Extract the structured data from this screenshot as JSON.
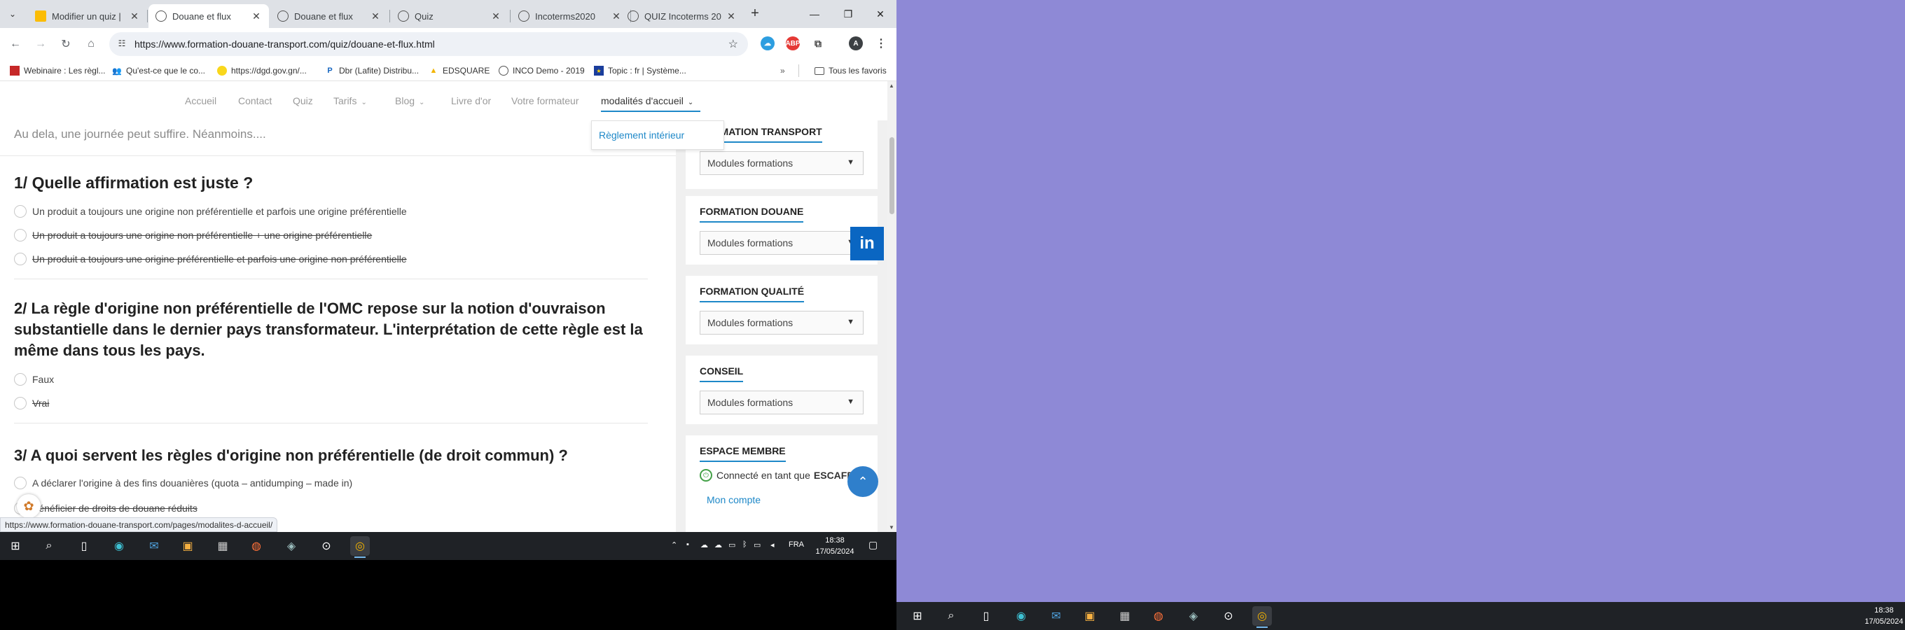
{
  "browser": {
    "tabs": [
      {
        "title": "Modifier un quiz |",
        "active": false
      },
      {
        "title": "Douane et flux",
        "active": true
      },
      {
        "title": "Douane et flux",
        "active": false
      },
      {
        "title": "Quiz",
        "active": false
      },
      {
        "title": "Incoterms2020",
        "active": false
      },
      {
        "title": "QUIZ Incoterms 20",
        "active": false
      }
    ],
    "url": "https://www.formation-douane-transport.com/quiz/douane-et-flux.html",
    "bookmarks": [
      "Webinaire : Les règl...",
      "Qu'est-ce que le co...",
      "https://dgd.gov.gn/...",
      "Dbr (Lafite) Distribu...",
      "EDSQUARE",
      "INCO Demo - 2019",
      "Topic : fr | Système..."
    ],
    "all_bookmarks": "Tous les favoris",
    "profile_initial": "A",
    "status_url": "https://www.formation-douane-transport.com/pages/modalites-d-accueil/"
  },
  "site_nav": {
    "items": [
      "Accueil",
      "Contact",
      "Quiz",
      "Tarifs",
      "Blog",
      "Livre d'or",
      "Votre formateur",
      "modalités d'accueil"
    ],
    "dropdown_item": "Règlement intérieur"
  },
  "content": {
    "intro": "Au dela, une journée peut suffire. Néanmoins....",
    "questions": [
      {
        "title": "1/ Quelle affirmation est juste ?",
        "answers": [
          {
            "text": "Un produit a toujours une origine non préférentielle et parfois une origine préférentielle",
            "struck": false
          },
          {
            "text": "Un produit a toujours une origine non préférentielle + une origine préférentielle",
            "struck": true
          },
          {
            "text": "Un produit a toujours une origine préférentielle et parfois une origine non préférentielle",
            "struck": true
          }
        ]
      },
      {
        "title": "2/ La règle d'origine non préférentielle de l'OMC repose sur la notion d'ouvraison substantielle dans le dernier pays transformateur. L'interprétation de cette règle est la même dans tous les pays.",
        "answers": [
          {
            "text": "Faux",
            "struck": false
          },
          {
            "text": "Vrai",
            "struck": true
          }
        ]
      },
      {
        "title": "3/ A quoi servent les règles d'origine non préférentielle (de droit commun) ?",
        "answers": [
          {
            "text": "A déclarer l'origine à des fins douanières (quota – antidumping – made in)",
            "struck": false
          },
          {
            "text": "Bénéficier de droits de douane réduits",
            "struck": true
          }
        ]
      }
    ]
  },
  "sidebar": {
    "widgets": [
      {
        "title": "FORMATION TRANSPORT",
        "select": "Modules formations"
      },
      {
        "title": "FORMATION DOUANE",
        "select": "Modules formations"
      },
      {
        "title": "FORMATION QUALITÉ",
        "select": "Modules formations"
      },
      {
        "title": "CONSEIL",
        "select": "Modules formations"
      }
    ],
    "member": {
      "title": "ESPACE MEMBRE",
      "connected_prefix": "Connecté en tant que",
      "username": "ESCAFFRE",
      "account_link": "Mon compte"
    }
  },
  "taskbar": {
    "lang": "FRA",
    "time": "18:38",
    "date": "17/05/2024"
  },
  "colors": {
    "accent": "#1e88c8",
    "linkedin": "#0a66c2",
    "desktop": "#8e89d6",
    "taskbar": "#1f2226"
  }
}
